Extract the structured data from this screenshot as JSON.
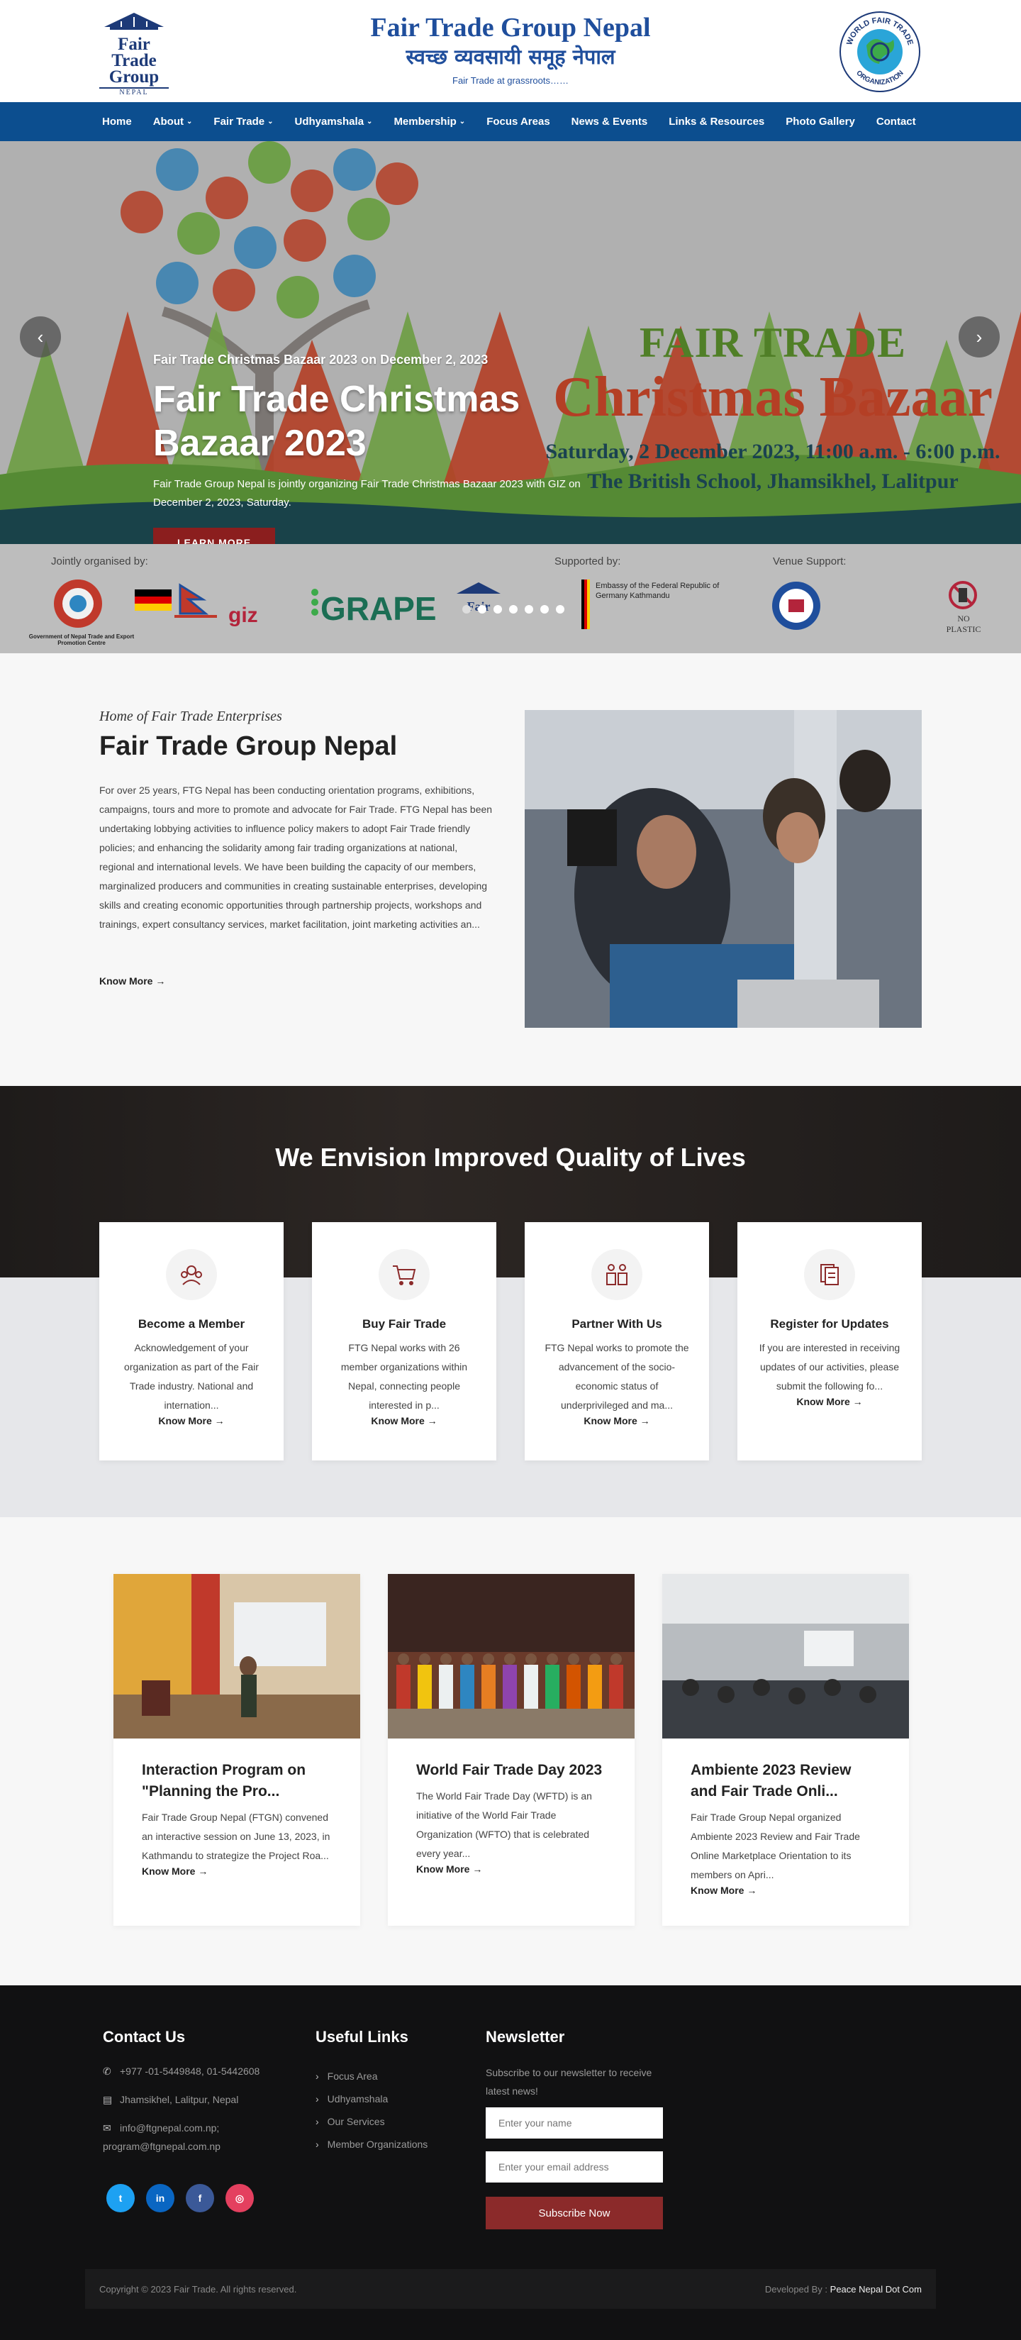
{
  "header": {
    "logo_left_lines": [
      "Fair",
      "Trade",
      "Group"
    ],
    "logo_left_small": "NEPAL",
    "title": "Fair Trade Group Nepal",
    "title_nepali": "स्वच्छ व्यवसायी समूह नेपाल",
    "tagline": "Fair Trade at grassroots……",
    "logo_right_text": "WORLD FAIR TRADE ORGANIZATION"
  },
  "nav": [
    {
      "label": "Home",
      "dropdown": false
    },
    {
      "label": "About",
      "dropdown": true
    },
    {
      "label": "Fair Trade",
      "dropdown": true
    },
    {
      "label": "Udhyamshala",
      "dropdown": true
    },
    {
      "label": "Membership",
      "dropdown": true
    },
    {
      "label": "Focus Areas",
      "dropdown": false
    },
    {
      "label": "News & Events",
      "dropdown": false
    },
    {
      "label": "Links & Resources",
      "dropdown": false
    },
    {
      "label": "Photo Gallery",
      "dropdown": false
    },
    {
      "label": "Contact",
      "dropdown": false
    }
  ],
  "hero": {
    "poster_line1": "FAIR TRADE",
    "poster_line2": "Christmas Bazaar",
    "poster_line3": "Saturday, 2 December 2023, 11:00 a.m. - 6:00 p.m.",
    "poster_line4": "The British School, Jhamsikhel, Lalitpur",
    "subtitle": "Fair Trade Christmas Bazaar 2023 on December 2, 2023",
    "title": "Fair Trade Christmas Bazaar 2023",
    "text": "Fair Trade Group Nepal is jointly organizing Fair Trade Christmas Bazaar 2023 with GIZ on December 2, 2023, Saturday.",
    "button": "LEARN MORE",
    "prev": "‹",
    "next": "›",
    "slide_count": 7
  },
  "sponsors": {
    "jointly": "Jointly organised by:",
    "supported": "Supported by:",
    "venue": "Venue Support:",
    "gov_text": "Government of Nepal Trade and Export Promotion Centre",
    "grape": "GRAPE",
    "embassy": "Embassy of the Federal Republic of Germany Kathmandu",
    "no_plastic": "NO PLASTIC",
    "giz": "giz"
  },
  "intro": {
    "kicker": "Home of Fair Trade Enterprises",
    "title": "Fair Trade Group Nepal",
    "text": "For over 25 years, FTG Nepal has been conducting orientation programs, exhibitions, campaigns, tours and more to promote and advocate for Fair Trade. FTG Nepal has been undertaking lobbying activities to influence policy makers to adopt Fair Trade friendly policies; and enhancing the solidarity among fair trading organizations at national, regional and international levels. We have been building the capacity of our members, marginalized producers and communities in creating sustainable enterprises, developing skills and creating economic opportunities through partnership projects, workshops and trainings, expert consultancy services, market facilitation, joint marketing activities an...",
    "more": "Know More →"
  },
  "envision": {
    "heading": "We Envision Improved Quality of Lives",
    "cards": [
      {
        "title": "Become a Member",
        "text": "Acknowledgement of your organization as part of the Fair Trade industry. National and internation...",
        "more": "Know More →",
        "icon": "members-icon"
      },
      {
        "title": "Buy Fair Trade",
        "text": "FTG Nepal works with 26 member organizations within Nepal, connecting people interested in p...",
        "more": "Know More →",
        "icon": "cart-icon"
      },
      {
        "title": "Partner With Us",
        "text": "FTG Nepal works to promote the advancement of the socio-economic status of underprivileged and ma...",
        "more": "Know More →",
        "icon": "partners-icon"
      },
      {
        "title": "Register for Updates",
        "text": "If you are interested in receiving updates of our activities, please submit the following fo...",
        "more": "Know More →",
        "icon": "documents-icon"
      }
    ]
  },
  "news": [
    {
      "title": "Interaction Program on \"Planning the Pro...",
      "text": "Fair Trade Group Nepal (FTGN) convened an interactive session on June 13, 2023, in Kathmandu to strategize the Project Roa...",
      "more": "Know More →"
    },
    {
      "title": "World Fair Trade Day 2023",
      "text": "The World Fair Trade Day (WFTD) is an initiative of the World Fair Trade Organization (WFTO) that is celebrated every year...",
      "more": "Know More →"
    },
    {
      "title": "Ambiente 2023 Review and Fair Trade Onli...",
      "text": "Fair Trade Group Nepal organized Ambiente 2023 Review and Fair Trade Online Marketplace Orientation to its members on Apri...",
      "more": "Know More →"
    }
  ],
  "footer": {
    "contact_heading": "Contact Us",
    "phone": "+977 -01-5449848, 01-5442608",
    "address": "Jhamsikhel, Lalitpur, Nepal",
    "email": "info@ftgnepal.com.np; program@ftgnepal.com.np",
    "socials": [
      {
        "name": "twitter",
        "glyph": "t",
        "color": "#1da1f2"
      },
      {
        "name": "linkedin",
        "glyph": "in",
        "color": "#0a66c2"
      },
      {
        "name": "facebook",
        "glyph": "f",
        "color": "#3b5998"
      },
      {
        "name": "instagram",
        "glyph": "◎",
        "color": "#e4405f"
      }
    ],
    "links_heading": "Useful Links",
    "links": [
      "Focus Area",
      "Udhyamshala",
      "Our Services",
      "Member Organizations"
    ],
    "newsletter_heading": "Newsletter",
    "newsletter_text": "Subscribe to our newsletter to receive latest news!",
    "name_placeholder": "Enter your name",
    "email_placeholder": "Enter your email address",
    "subscribe": "Subscribe Now",
    "copyright": "Copyright © 2023 Fair Trade. All rights reserved.",
    "developed_by_label": "Developed By :",
    "developed_by": "Peace Nepal Dot Com"
  }
}
